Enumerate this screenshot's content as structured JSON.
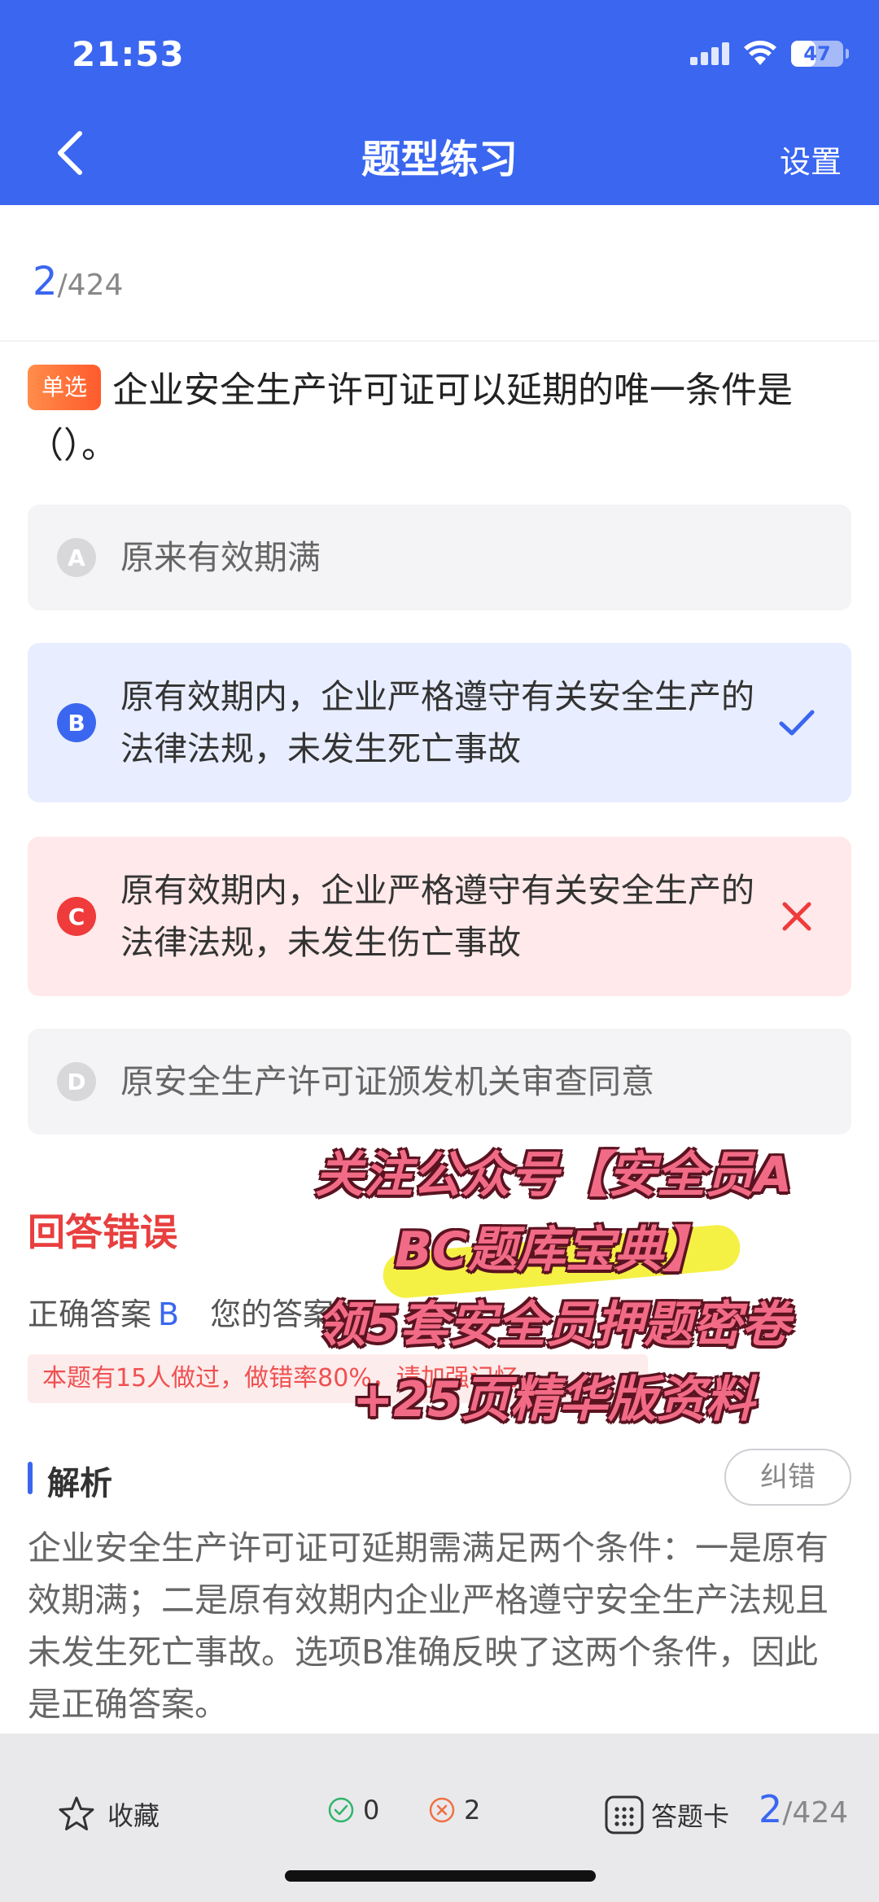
{
  "status_bar": {
    "time": "21:53",
    "battery": "47"
  },
  "header": {
    "title": "题型练习",
    "settings_label": "设置"
  },
  "counter": {
    "current": "2",
    "total": "/424"
  },
  "question": {
    "type_tag": "单选",
    "text": "企业安全生产许可证可以延期的唯一条件是（）。"
  },
  "options": [
    {
      "letter": "A",
      "text": "原来有效期满",
      "state": "default"
    },
    {
      "letter": "B",
      "text": "原有效期内，企业严格遵守有关安全生产的法律法规，未发生死亡事故",
      "state": "correct"
    },
    {
      "letter": "C",
      "text": "原有效期内，企业严格遵守有关安全生产的法律法规，未发生伤亡事故",
      "state": "wrong"
    },
    {
      "letter": "D",
      "text": "原安全生产许可证颁发机关审查同意",
      "state": "default"
    }
  ],
  "result": {
    "title": "回答错误",
    "correct_label": "正确答案",
    "correct_value": "B",
    "your_label": "您的答案",
    "stat_text": "本题有15人做过，做错率80%，请加强记忆"
  },
  "analysis": {
    "title": "解析",
    "report_label": "纠错",
    "text": "企业安全生产许可证可延期需满足两个条件：一是原有效期满；二是原有效期内企业严格遵守安全生产法规且未发生死亡事故。选项B准确反映了这两个条件，因此是正确答案。"
  },
  "watermark": {
    "line1": "关注公众号【安全员A",
    "line2": "BC题库宝典】",
    "line3": "领5套安全员押题密卷",
    "line4": "+25页精华版资料"
  },
  "bottom_bar": {
    "favorite_label": "收藏",
    "correct_count": "0",
    "wrong_count": "2",
    "answer_card_label": "答题卡",
    "current": "2",
    "total": "/424"
  },
  "colors": {
    "primary": "#3a66f0",
    "error": "#e83f3f",
    "tag": "#ff6a34",
    "watermark": "#f26b86"
  }
}
